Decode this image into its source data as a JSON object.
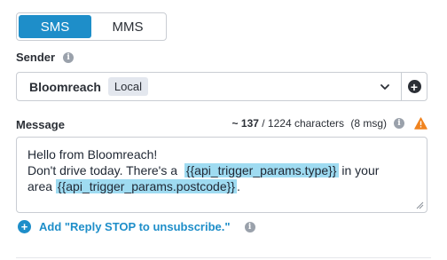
{
  "channel_toggle": {
    "options": [
      "SMS",
      "MMS"
    ],
    "selected": "SMS"
  },
  "sender": {
    "label": "Sender",
    "value": "Bloomreach",
    "badge": "Local"
  },
  "message": {
    "label": "Message",
    "counter_approx": "~ 137",
    "counter_rest": "/ 1224 characters",
    "counter_msgs": "(8 msg)",
    "line1": "Hello from Bloomreach!",
    "line2_prefix": "Don't drive today. There's a",
    "token1": "{{api_trigger_params.type}}",
    "line2_suffix": "in your",
    "line3_prefix": "area",
    "token2": "{{api_trigger_params.postcode}}",
    "line3_suffix": "."
  },
  "add_stop": {
    "label": "Add \"Reply STOP to unsubscribe.\""
  },
  "icons": [
    "info-icon",
    "chevron-down-icon",
    "plus-circle-icon",
    "warning-icon",
    "resize-handle-icon"
  ],
  "colors": {
    "accent": "#1e8ec9",
    "token_highlight": "#9fdbf1",
    "warning": "#f0831f"
  }
}
